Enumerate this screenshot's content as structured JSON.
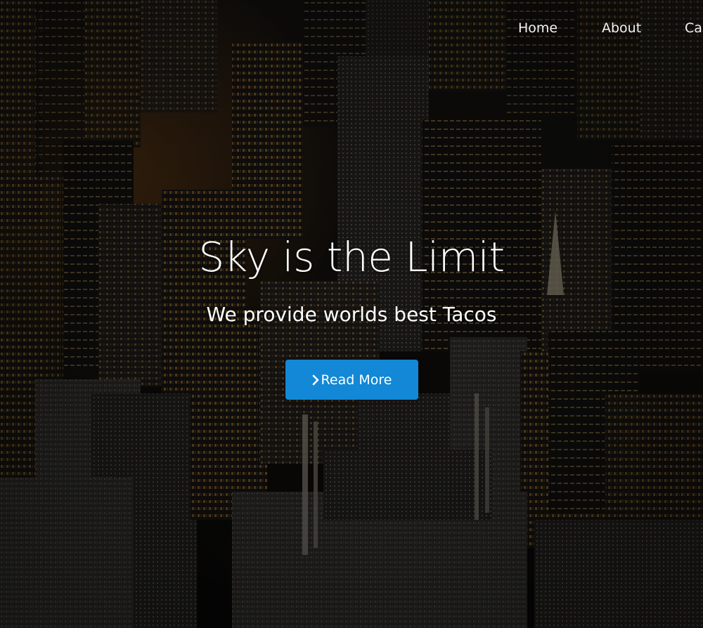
{
  "nav": {
    "items": [
      {
        "label": "Home"
      },
      {
        "label": "About"
      },
      {
        "label": "Cas"
      }
    ]
  },
  "hero": {
    "title": "Sky is the Limit",
    "subtitle": "We provide worlds best Tacos",
    "button_label": "Read More",
    "button_icon": "chevron-right-icon",
    "accent_color": "#1288d6"
  }
}
